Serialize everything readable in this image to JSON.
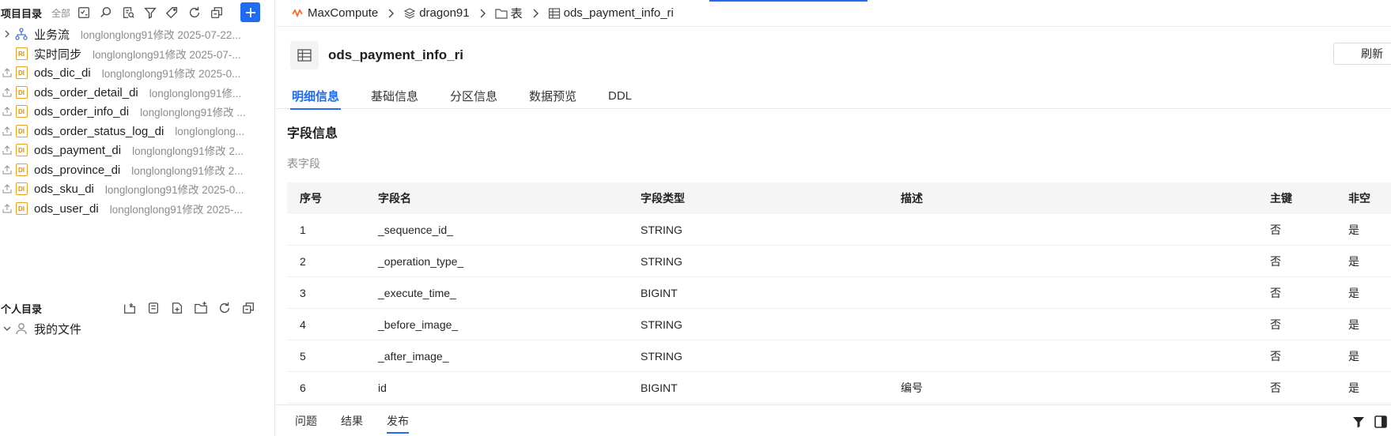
{
  "sidebar": {
    "project_title": "项目目录",
    "project_filter": "全部",
    "items": [
      {
        "name": "业务流",
        "meta": "longlonglong91修改 2025-07-22...",
        "icon": "workflow-icon",
        "expand": true
      },
      {
        "name": "实时同步",
        "meta": "longlonglong91修改 2025-07-...",
        "icon": "realtime-sync-icon",
        "expand": false
      },
      {
        "name": "ods_dic_di",
        "meta": "longlonglong91修改 2025-0...",
        "icon": "di-node-icon",
        "expand": false
      },
      {
        "name": "ods_order_detail_di",
        "meta": "longlonglong91修...",
        "icon": "di-node-icon",
        "expand": false
      },
      {
        "name": "ods_order_info_di",
        "meta": "longlonglong91修改 ...",
        "icon": "di-node-icon",
        "expand": false
      },
      {
        "name": "ods_order_status_log_di",
        "meta": "longlonglong...",
        "icon": "di-node-icon",
        "expand": false
      },
      {
        "name": "ods_payment_di",
        "meta": "longlonglong91修改 2...",
        "icon": "di-node-icon",
        "expand": false
      },
      {
        "name": "ods_province_di",
        "meta": "longlonglong91修改 2...",
        "icon": "di-node-icon",
        "expand": false
      },
      {
        "name": "ods_sku_di",
        "meta": "longlonglong91修改 2025-0...",
        "icon": "di-node-icon",
        "expand": false
      },
      {
        "name": "ods_user_di",
        "meta": "longlonglong91修改 2025-...",
        "icon": "di-node-icon",
        "expand": false
      }
    ],
    "personal_title": "个人目录",
    "my_files": "我的文件",
    "node_badge": "DI",
    "rt_badge": "RI"
  },
  "breadcrumb": {
    "items": [
      "MaxCompute",
      "dragon91",
      "表",
      "ods_payment_info_ri"
    ]
  },
  "header": {
    "table_name": "ods_payment_info_ri",
    "refresh": "刷新"
  },
  "tabs": [
    "明细信息",
    "基础信息",
    "分区信息",
    "数据预览",
    "DDL"
  ],
  "section": {
    "title": "字段信息",
    "subtitle": "表字段"
  },
  "fields": {
    "columns": [
      "序号",
      "字段名",
      "字段类型",
      "描述",
      "主键",
      "非空"
    ],
    "rows": [
      {
        "no": "1",
        "name": "_sequence_id_",
        "type": "STRING",
        "desc": "",
        "pk": "否",
        "nn": "是"
      },
      {
        "no": "2",
        "name": "_operation_type_",
        "type": "STRING",
        "desc": "",
        "pk": "否",
        "nn": "是"
      },
      {
        "no": "3",
        "name": "_execute_time_",
        "type": "BIGINT",
        "desc": "",
        "pk": "否",
        "nn": "是"
      },
      {
        "no": "4",
        "name": "_before_image_",
        "type": "STRING",
        "desc": "",
        "pk": "否",
        "nn": "是"
      },
      {
        "no": "5",
        "name": "_after_image_",
        "type": "STRING",
        "desc": "",
        "pk": "否",
        "nn": "是"
      },
      {
        "no": "6",
        "name": "id",
        "type": "BIGINT",
        "desc": "编号",
        "pk": "否",
        "nn": "是"
      }
    ]
  },
  "bottom_tabs": [
    "问题",
    "结果",
    "发布"
  ],
  "colors": {
    "accent": "#1f6bf2",
    "di_badge": "#f0a020"
  }
}
